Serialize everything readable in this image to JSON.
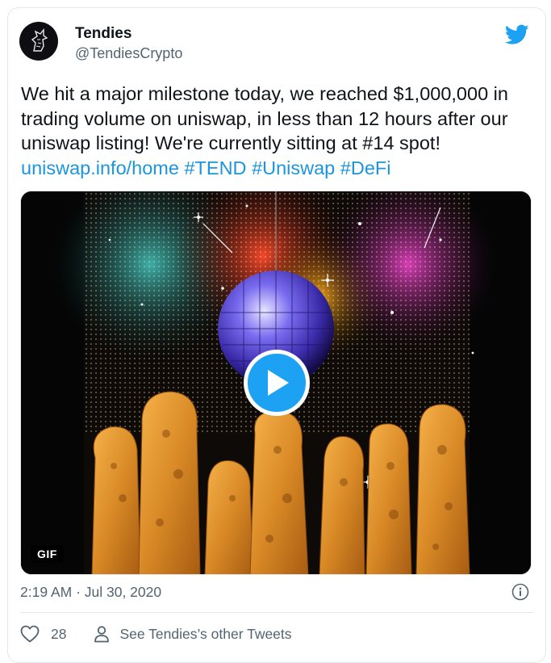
{
  "user": {
    "name": "Tendies",
    "handle": "@TendiesCrypto"
  },
  "tweet": {
    "text": "We hit a major milestone today, we reached $1,000,000 in trading volume on uniswap, in less than 12 hours after our uniswap listing! We're currently sitting at #14 spot! ",
    "links": [
      "uniswap.info/home",
      "#TEND",
      "#Uniswap",
      "#DeFi"
    ]
  },
  "media": {
    "badge": "GIF",
    "play_icon": "play-icon"
  },
  "meta": {
    "timestamp": "2:19 AM · Jul 30, 2020"
  },
  "actions": {
    "like_count": "28",
    "other_tweets": "See Tendies’s other Tweets"
  },
  "colors": {
    "accent": "#1da1f2",
    "link": "#1b95e0",
    "secondary_text": "#536471"
  }
}
